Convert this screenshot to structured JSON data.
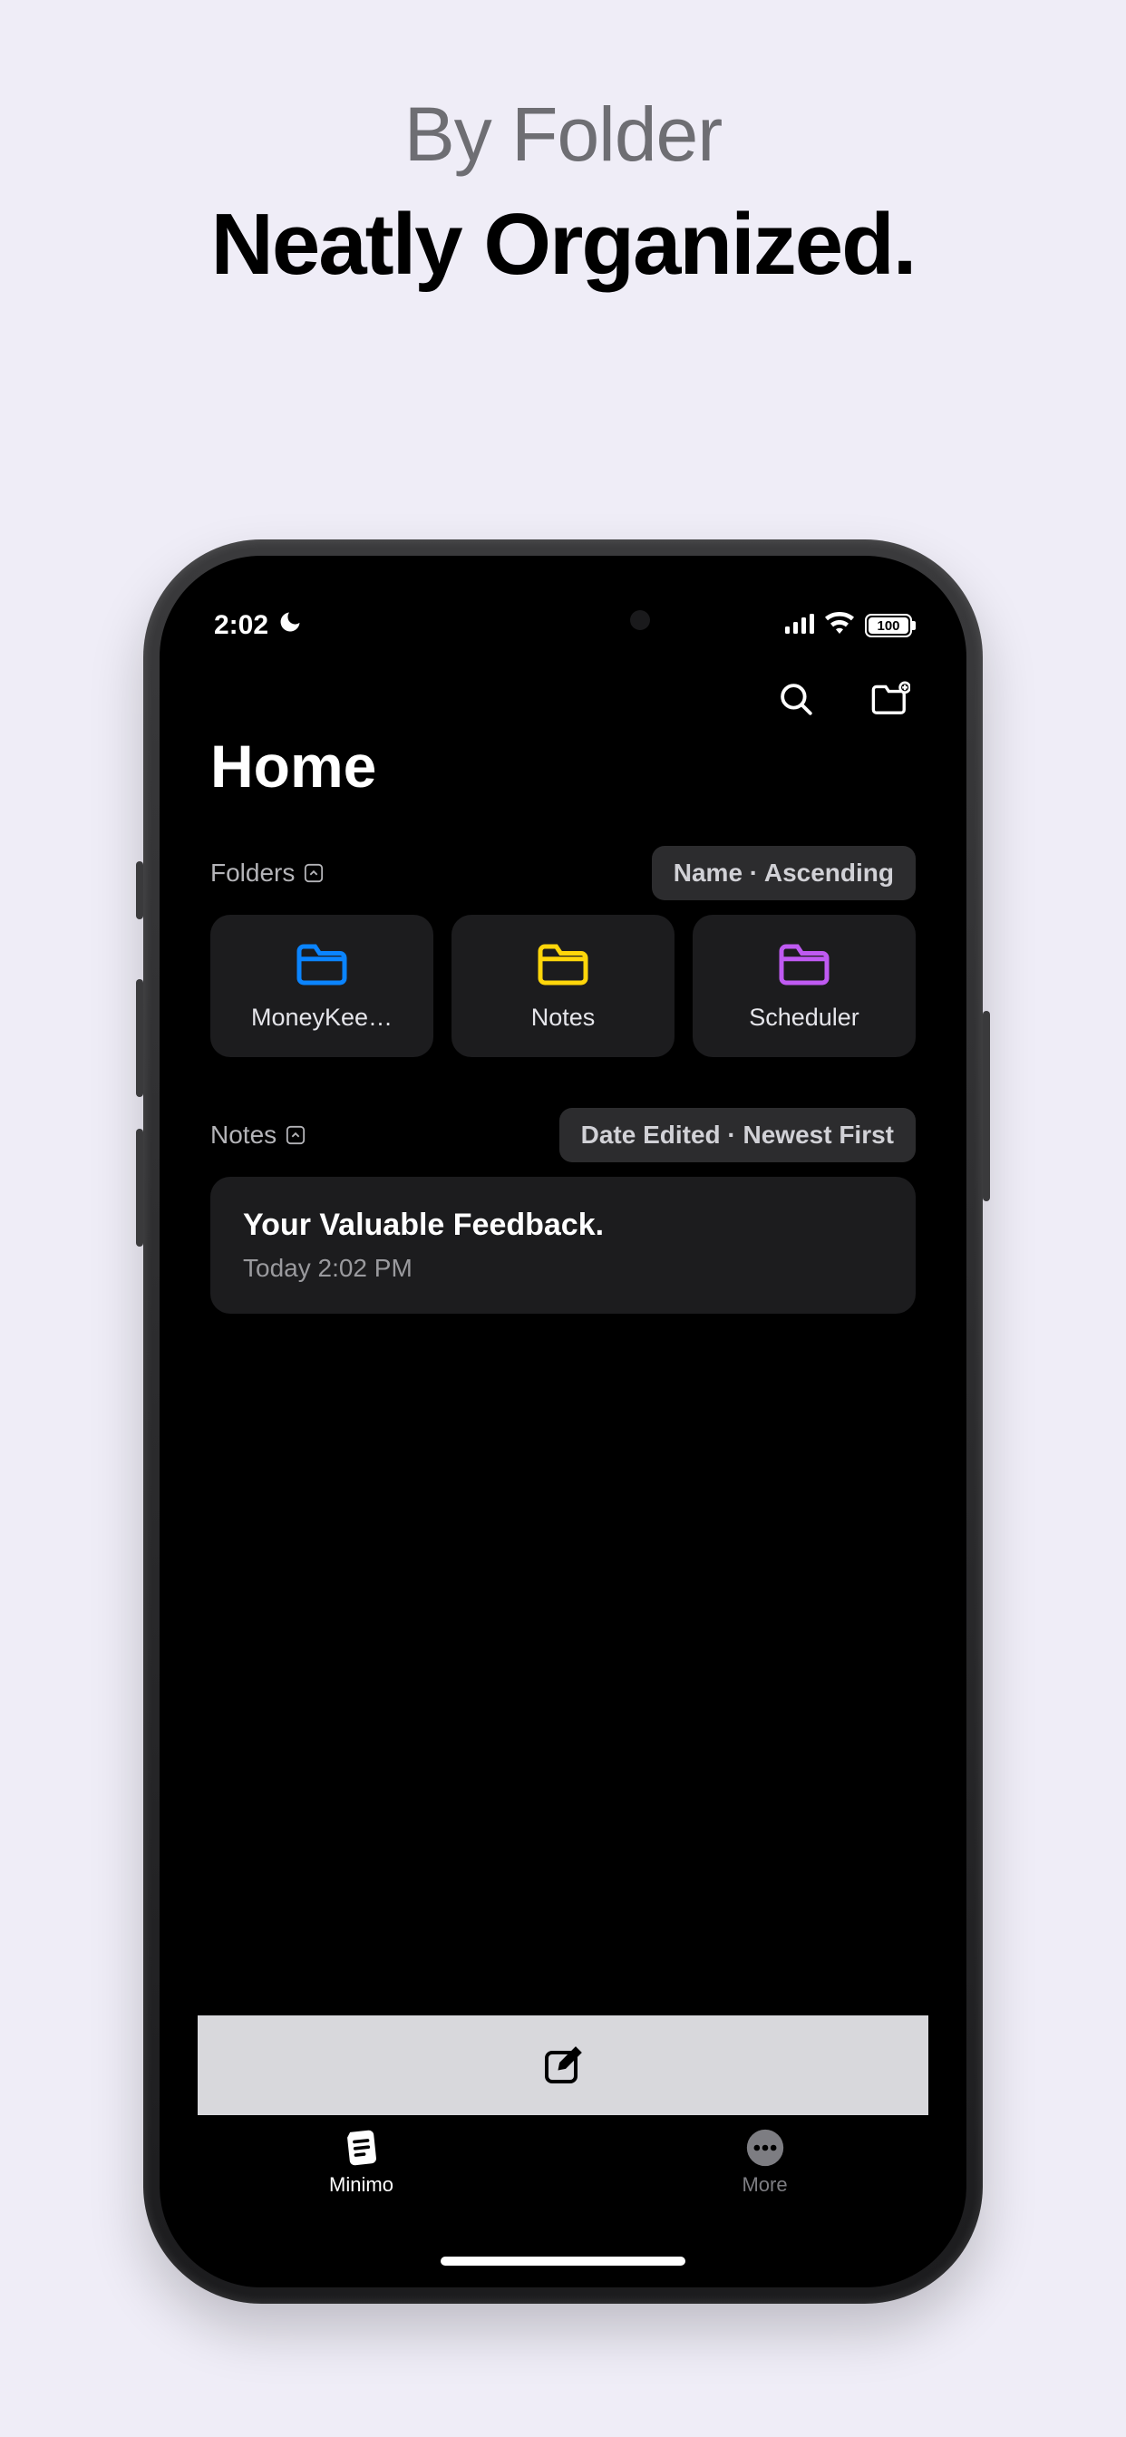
{
  "hero": {
    "subtitle": "By Folder",
    "title": "Neatly Organized."
  },
  "status": {
    "time": "2:02",
    "battery_level": "100"
  },
  "app": {
    "title": "Home",
    "folders": {
      "section_label": "Folders",
      "sort_label": "Name · Ascending",
      "items": [
        {
          "name": "MoneyKee…",
          "color": "#0a84ff"
        },
        {
          "name": "Notes",
          "color": "#ffd60a"
        },
        {
          "name": "Scheduler",
          "color": "#bf5af2"
        }
      ]
    },
    "notes_section": {
      "section_label": "Notes",
      "sort_label": "Date Edited · Newest First",
      "items": [
        {
          "title": "Your Valuable Feedback.",
          "meta": "Today 2:02 PM"
        }
      ]
    },
    "tabs": {
      "minimo": "Minimo",
      "more": "More"
    }
  }
}
